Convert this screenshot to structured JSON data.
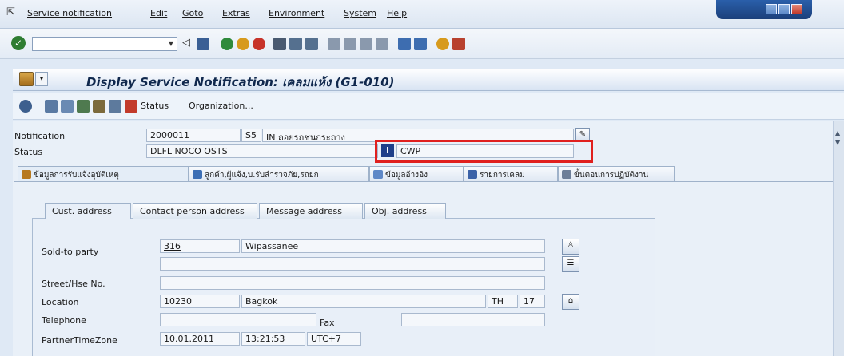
{
  "menu": {
    "items": [
      "Service notification",
      "Edit",
      "Goto",
      "Extras",
      "Environment",
      "System",
      "Help"
    ]
  },
  "title": "Display Service Notification: เคลมแห้ง (G1-010)",
  "apptoolbar": {
    "status_label": "Status",
    "organization_label": "Organization..."
  },
  "header": {
    "notification_label": "Notification",
    "notification_number": "2000011",
    "notification_type": "S5",
    "notification_desc": "IN ถอยรถชนกระถาง",
    "status_label": "Status",
    "system_status": "DLFL NOCO OSTS",
    "user_status": "CWP"
  },
  "tabs": [
    "ข้อมูลการรับแจ้งอุบัติเหตุ",
    "ลูกค้า,ผู้แจ้ง,บ.รับสำรวจภัย,รถยก",
    "ข้อมูลอ้างอิง",
    "รายการเคลม",
    "ขั้นตอนการปฏิบัติงาน"
  ],
  "subtabs": [
    "Cust. address",
    "Contact person address",
    "Message address",
    "Obj. address"
  ],
  "form": {
    "sold_to_label": "Sold-to party",
    "sold_to_number": "316",
    "sold_to_name": "Wipassanee",
    "street_label": "Street/Hse No.",
    "location_label": "Location",
    "postal_code": "10230",
    "city": "Bagkok",
    "country": "TH",
    "region": "17",
    "telephone_label": "Telephone",
    "fax_label": "Fax",
    "timezone_label": "PartnerTimeZone",
    "date": "10.01.2011",
    "time": "13:21:53",
    "timezone": "UTC+7"
  },
  "colors": {
    "highlight": "#e0201e",
    "title_text": "#10284d",
    "window_control": "#1b3f7a"
  }
}
